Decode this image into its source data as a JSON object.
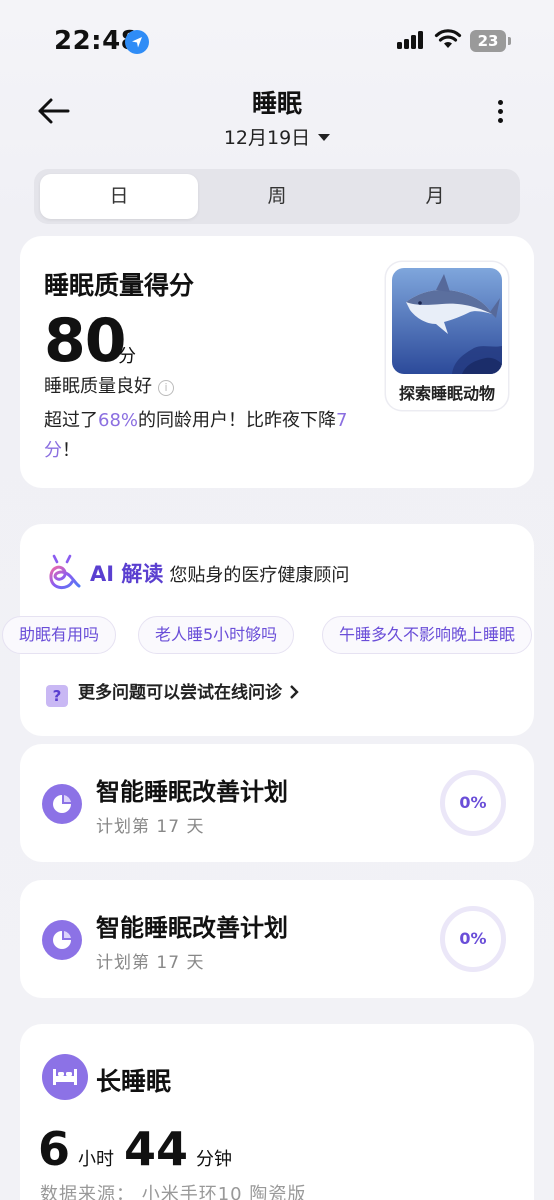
{
  "status_bar": {
    "time": "22:48",
    "battery": "23"
  },
  "header": {
    "title": "睡眠",
    "date": "12月19日"
  },
  "tabs": [
    {
      "label": "日"
    },
    {
      "label": "周"
    },
    {
      "label": "月"
    }
  ],
  "score_card": {
    "title": "睡眠质量得分",
    "score": "80",
    "unit": "分",
    "quality": "睡眠质量良好",
    "compare_pre": "超过了",
    "compare_pct": "68%",
    "compare_mid": "的同龄用户！比昨夜下降",
    "compare_drop": "7分",
    "compare_end": "！",
    "animal_label": "探索睡眠动物"
  },
  "ai_card": {
    "title": "AI 解读",
    "subtitle": "您贴身的医疗健康顾问",
    "chips": [
      "助眠有用吗",
      "老人睡5小时够吗",
      "午睡多久不影响晚上睡眠"
    ],
    "more_questions": "更多问题可以尝试在线问诊"
  },
  "plans": [
    {
      "title": "智能睡眠改善计划",
      "subtitle": "计划第 17 天",
      "progress": "0%"
    },
    {
      "title": "智能睡眠改善计划",
      "subtitle": "计划第 17 天",
      "progress": "0%"
    }
  ],
  "long_sleep": {
    "title": "长睡眠",
    "hours": "6",
    "hours_unit": "小时",
    "minutes": "44",
    "minutes_unit": "分钟",
    "source": "数据来源：  小米手环10 陶瓷版"
  },
  "colors": {
    "accent": "#8c72e6",
    "highlight": "#8b6fe0",
    "location": "#2f8cf6"
  }
}
